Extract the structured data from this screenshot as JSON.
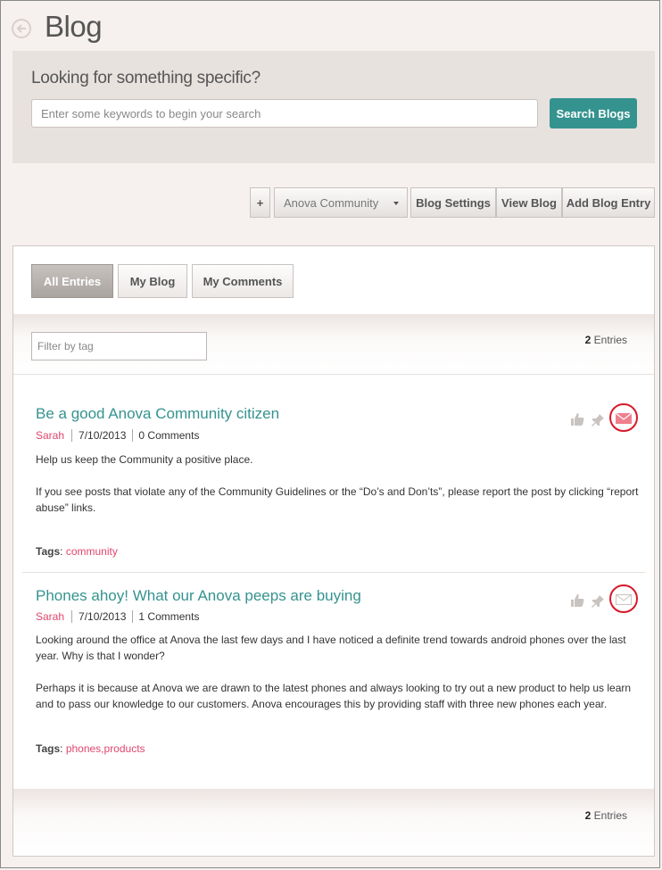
{
  "page": {
    "title": "Blog"
  },
  "search": {
    "heading": "Looking for something specific?",
    "placeholder": "Enter some keywords to begin your search",
    "button_label": "Search Blogs"
  },
  "toolbar": {
    "plus_label": "+",
    "community_select": "Anova Community",
    "settings_label": "Blog Settings",
    "view_label": "View Blog",
    "add_label": "Add Blog Entry"
  },
  "tabs": [
    {
      "label": "All Entries",
      "active": true
    },
    {
      "label": "My Blog",
      "active": false
    },
    {
      "label": "My Comments",
      "active": false
    }
  ],
  "filter": {
    "placeholder": "Filter by tag"
  },
  "entries_count": {
    "number": "2",
    "label": "Entries"
  },
  "entries": [
    {
      "title": "Be a good Anova Community citizen",
      "author": "Sarah",
      "date": "7/10/2013",
      "comments": "0 Comments",
      "paragraphs": [
        "Help us keep the Community a positive place.",
        "If you see posts that violate any of the Community Guidelines or the “Do’s and Don’ts”, please report the post by clicking “report abuse” links."
      ],
      "tags_label": "Tags",
      "tags_colon": ":",
      "tags": "community"
    },
    {
      "title": "Phones ahoy! What our Anova peeps are buying",
      "author": "Sarah",
      "date": "7/10/2013",
      "comments": "1 Comments",
      "paragraphs": [
        "Looking around the office at Anova the last few days and I have noticed a definite trend towards android phones over the last year. Why is that I wonder?",
        "Perhaps it is because at Anova we are drawn to the latest phones and always looking to try out a new product to help us learn and to pass our knowledge to our customers. Anova encourages this by providing staff with three new phones each year."
      ],
      "tags_label": "Tags",
      "tags_colon": ":",
      "tags": "phones,products"
    }
  ],
  "colors": {
    "accent": "#35938f",
    "author": "#e0476c",
    "highlight_ring": "#d8182a"
  },
  "icons": [
    "back-arrow-icon",
    "thumbs-up-icon",
    "pin-icon",
    "envelope-icon"
  ]
}
